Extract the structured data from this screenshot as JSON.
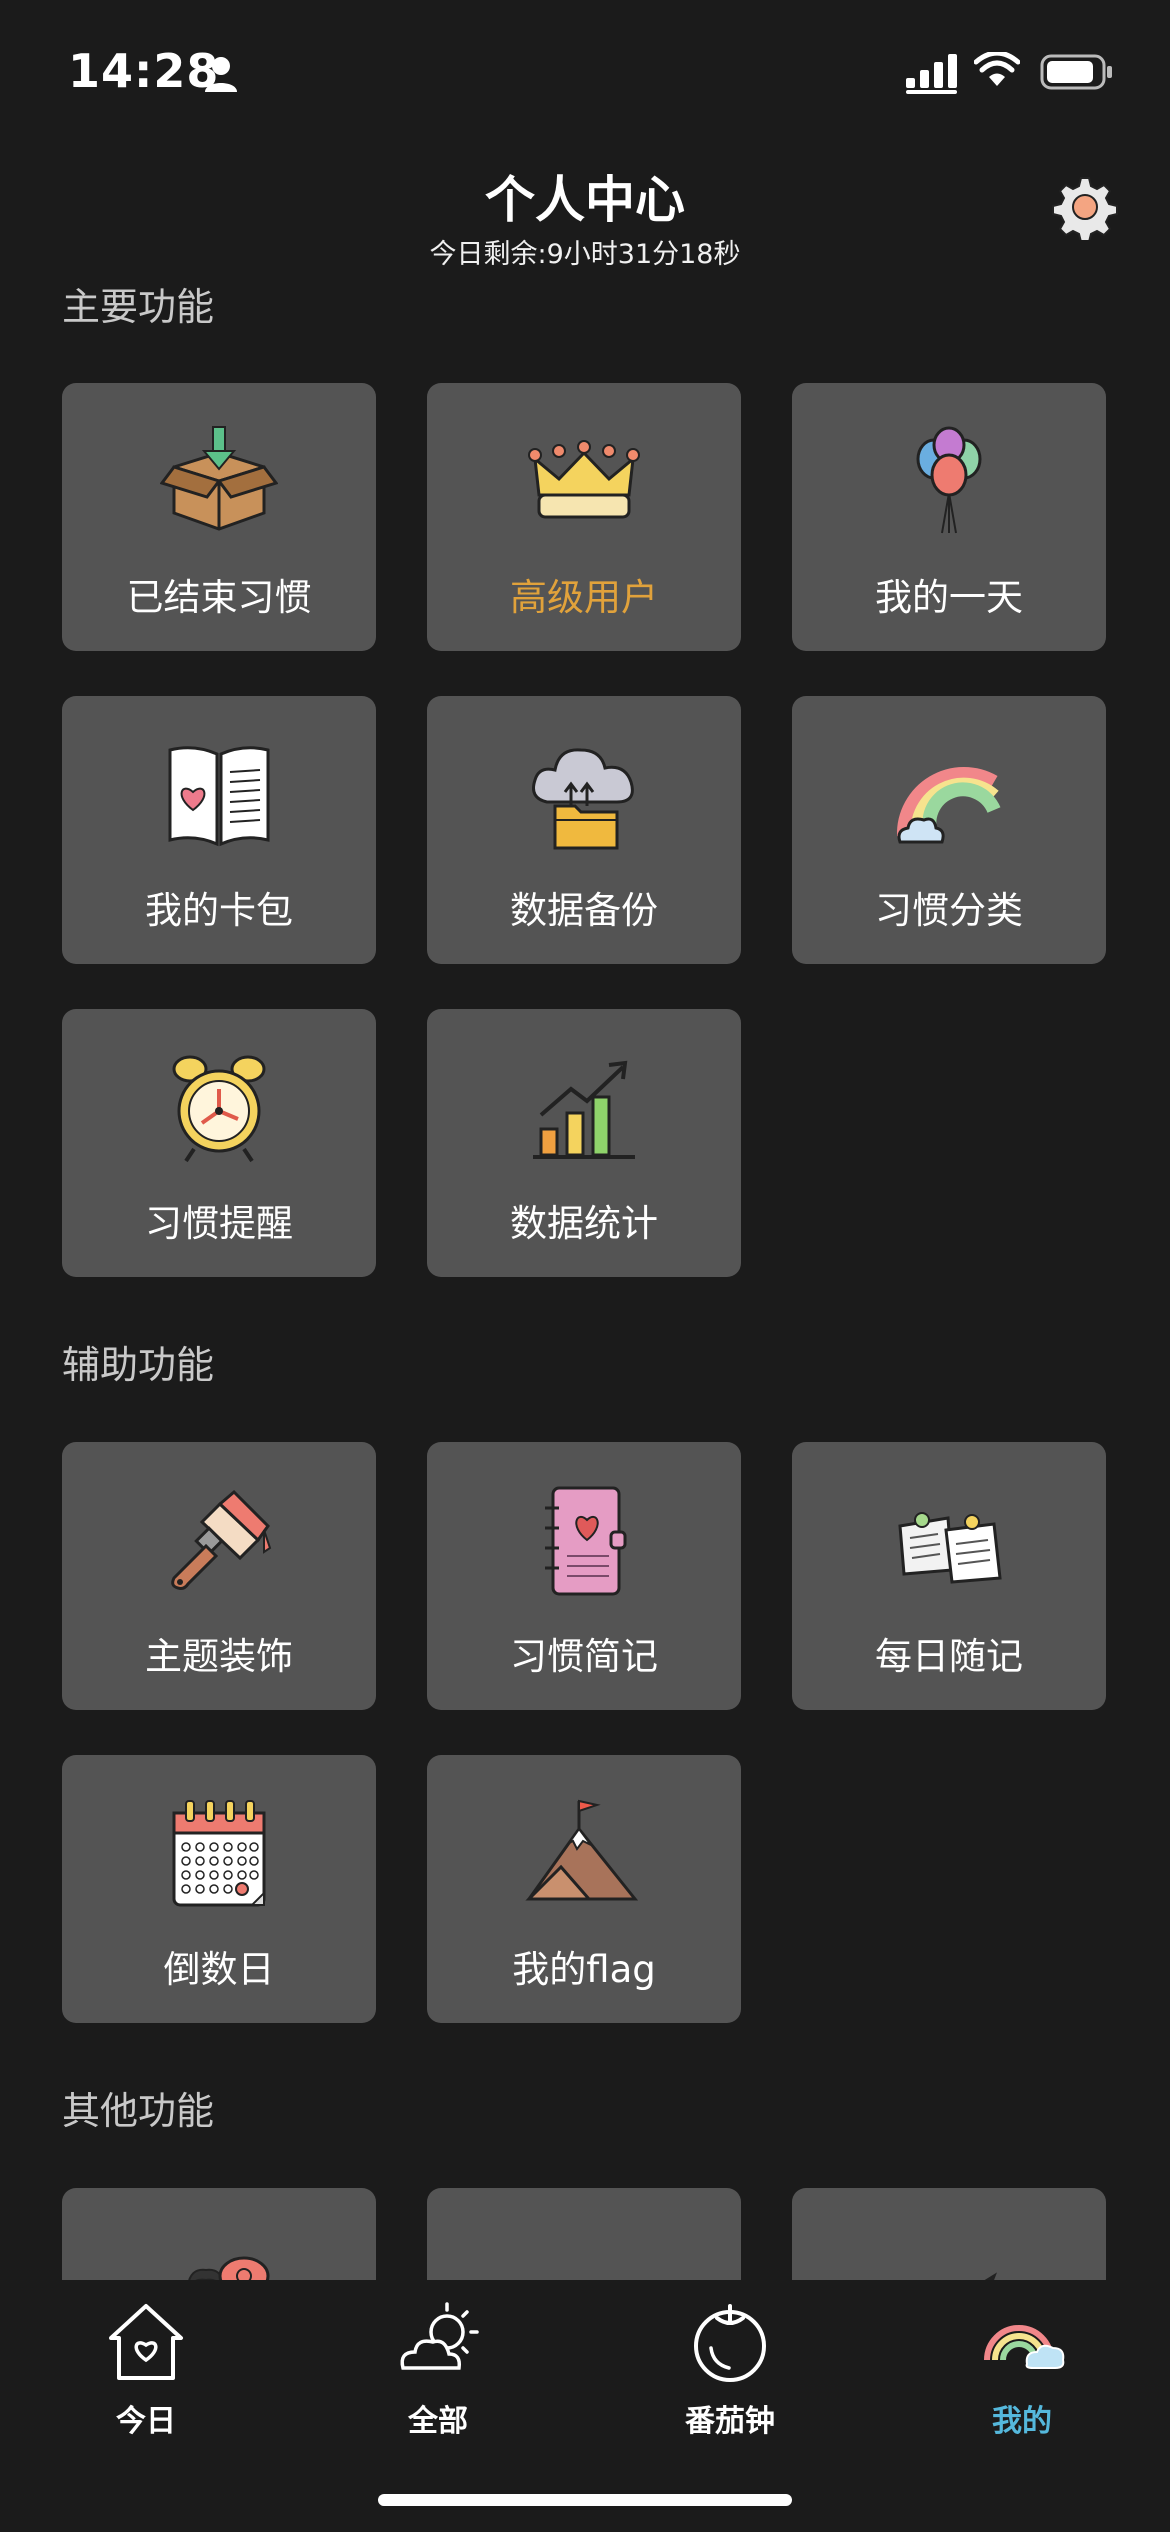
{
  "status_bar": {
    "time": "14:28"
  },
  "header": {
    "title": "个人中心",
    "subtitle": "今日剩余:9小时31分18秒"
  },
  "sections": [
    {
      "title": "主要功能",
      "items": [
        {
          "label": "已结束习惯",
          "icon": "box-icon"
        },
        {
          "label": "高级用户",
          "icon": "crown-icon",
          "color": "#e1a23b"
        },
        {
          "label": "我的一天",
          "icon": "balloons-icon"
        },
        {
          "label": "我的卡包",
          "icon": "card-book-icon"
        },
        {
          "label": "数据备份",
          "icon": "cloud-folder-icon"
        },
        {
          "label": "习惯分类",
          "icon": "rainbow-icon"
        },
        {
          "label": "习惯提醒",
          "icon": "alarm-clock-icon"
        },
        {
          "label": "数据统计",
          "icon": "bar-chart-icon"
        }
      ]
    },
    {
      "title": "辅助功能",
      "items": [
        {
          "label": "主题装饰",
          "icon": "paint-brush-icon"
        },
        {
          "label": "习惯简记",
          "icon": "notebook-icon"
        },
        {
          "label": "每日随记",
          "icon": "pinned-notes-icon"
        },
        {
          "label": "倒数日",
          "icon": "calendar-icon"
        },
        {
          "label": "我的flag",
          "icon": "mountain-flag-icon"
        }
      ]
    },
    {
      "title": "其他功能",
      "items": [
        {
          "label": "",
          "icon": "chat-person-icon"
        },
        {
          "label": "",
          "icon": "message-bubble-icon"
        },
        {
          "label": "",
          "icon": "paper-plane-icon"
        }
      ]
    }
  ],
  "tab_bar": {
    "tabs": [
      {
        "label": "今日",
        "icon": "home-heart-icon"
      },
      {
        "label": "全部",
        "icon": "sun-cloud-icon"
      },
      {
        "label": "番茄钟",
        "icon": "tomato-icon"
      },
      {
        "label": "我的",
        "icon": "rainbow-cloud-icon",
        "active": true
      }
    ],
    "active_color": "#55b8dc"
  }
}
